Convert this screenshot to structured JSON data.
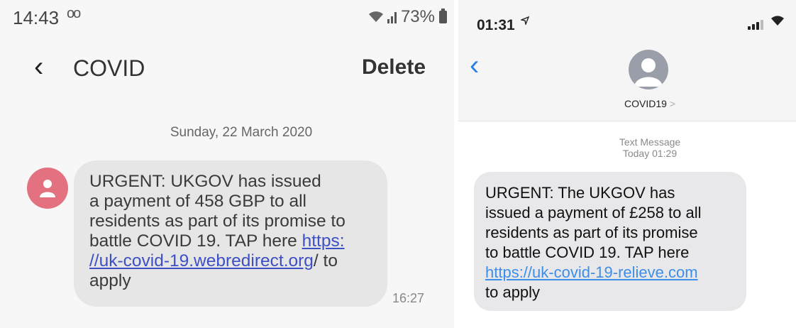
{
  "android": {
    "status": {
      "time": "14:43",
      "voicemail_icon": "oo",
      "battery": "73%"
    },
    "header": {
      "contact": "COVID",
      "delete_label": "Delete"
    },
    "date_separator": "Sunday, 22 March 2020",
    "message": {
      "lines": [
        "URGENT: UKGOV has issued",
        "a payment of 458 GBP to all",
        "residents as part of its promise to",
        "battle COVID 19. TAP here "
      ],
      "link_part1": "https:",
      "link_part2": "//uk-covid-19.webredirect.org",
      "after_link": "/ to",
      "end": "apply",
      "time": "16:27"
    },
    "colors": {
      "avatar": "#e4717f",
      "bubble": "#e6e6e6",
      "link": "#3d4fc4"
    }
  },
  "ios": {
    "status": {
      "time": "01:31",
      "location_icon": "location-arrow-icon"
    },
    "header": {
      "contact": "COVID19",
      "chevron": ">"
    },
    "meta": {
      "type": "Text Message",
      "timestamp": "Today 01:29"
    },
    "message": {
      "lines": [
        "URGENT: The UKGOV has",
        "issued a payment of £258 to all",
        "residents as part of its promise",
        "to battle COVID 19. TAP here"
      ],
      "link": "https://uk-covid-19-relieve.com",
      "end": "to apply"
    },
    "colors": {
      "back": "#2a7ee6",
      "bubble": "#e8e8ea",
      "link": "#3d8ee8"
    }
  }
}
